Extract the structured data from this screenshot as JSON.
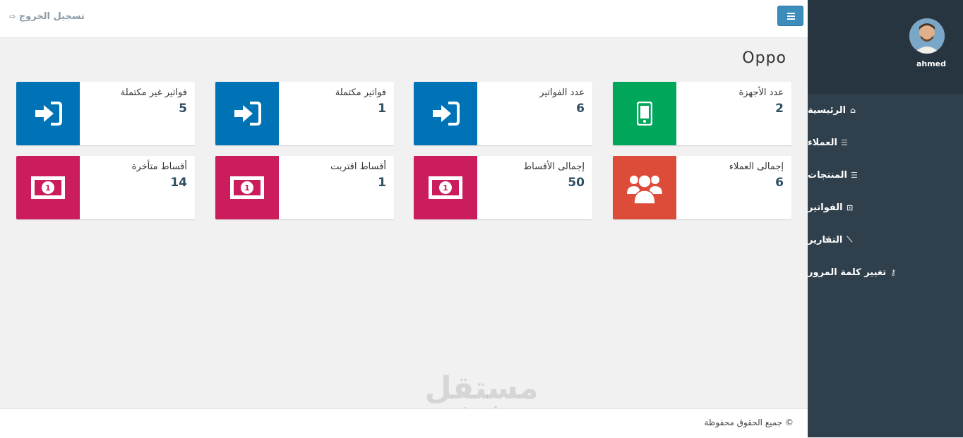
{
  "sidebar": {
    "username": "ahmed",
    "items": [
      {
        "label": "الرئيسية",
        "icon": "home-icon"
      },
      {
        "label": "العملاء",
        "icon": "list-icon"
      },
      {
        "label": "المنتجات",
        "icon": "list-icon"
      },
      {
        "label": "الفواتير",
        "icon": "invoice-icon"
      },
      {
        "label": "التقارير",
        "icon": "chart-icon"
      },
      {
        "label": "تغيير كلمة المرور",
        "icon": "key-icon"
      }
    ]
  },
  "topbar": {
    "logout_label": "تسجيل الخروج"
  },
  "page": {
    "title": "Oppo"
  },
  "cards": [
    {
      "label": "عدد الأجهزة",
      "value": "2",
      "color": "#00a65a",
      "icon": "mobile-icon"
    },
    {
      "label": "عدد الفواتير",
      "value": "6",
      "color": "#0073b7",
      "icon": "sign-in-icon"
    },
    {
      "label": "فواتير مكتملة",
      "value": "1",
      "color": "#0073b7",
      "icon": "sign-in-icon"
    },
    {
      "label": "فواتير غير مكتملة",
      "value": "5",
      "color": "#0073b7",
      "icon": "sign-in-icon"
    },
    {
      "label": "إجمالى العملاء",
      "value": "6",
      "color": "#dd4b39",
      "icon": "users-icon"
    },
    {
      "label": "إجمالى الأقساط",
      "value": "50",
      "color": "#cb1c5e",
      "icon": "money-icon"
    },
    {
      "label": "أقساط اقتربت",
      "value": "1",
      "color": "#cb1c5e",
      "icon": "money-icon"
    },
    {
      "label": "أقساط متأخرة",
      "value": "14",
      "color": "#cb1c5e",
      "icon": "money-icon"
    }
  ],
  "footer": {
    "copyright": "© جميع الحقوق محفوظة"
  },
  "watermark": {
    "arabic": "مستقل",
    "latin": "mostaql.com"
  }
}
